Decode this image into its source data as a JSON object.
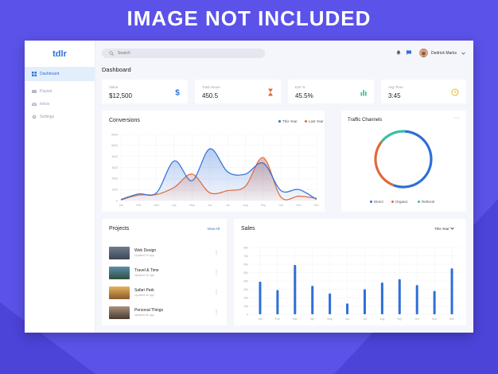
{
  "banner": {
    "text": "IMAGE NOT INCLUDED"
  },
  "sidebar": {
    "logo": "tdlr",
    "items": [
      {
        "label": "Dashboard",
        "icon": "grid-icon",
        "active": true
      },
      {
        "label": "Payout",
        "icon": "card-icon",
        "active": false
      },
      {
        "label": "Inbox",
        "icon": "mail-icon",
        "active": false
      },
      {
        "label": "Settings",
        "icon": "gear-icon",
        "active": false
      }
    ]
  },
  "header": {
    "search_placeholder": "Search",
    "user_name": "Dedrick Marks"
  },
  "page": {
    "title": "Dashboard"
  },
  "stats": [
    {
      "label": "Value",
      "value": "$12,500",
      "icon": "dollar-icon",
      "color": "#2e6fd8"
    },
    {
      "label": "Total Hours",
      "value": "450.5",
      "icon": "hourglass-icon",
      "color": "#e0683c"
    },
    {
      "label": "Exit %",
      "value": "45.5%",
      "icon": "bar-chart-icon",
      "color": "#36c08e"
    },
    {
      "label": "Avg Time",
      "value": "3:45",
      "icon": "clock-icon",
      "color": "#f0b429"
    }
  ],
  "conversions": {
    "title": "Conversions",
    "legend": {
      "this_year": "This Year",
      "last_year": "Last Year"
    },
    "colors": {
      "this_year": "#2e6fd8",
      "last_year": "#e0683c"
    }
  },
  "traffic": {
    "title": "Traffic Channels",
    "legend": [
      "Direct",
      "Organic",
      "Referral"
    ],
    "colors": [
      "#2e6fd8",
      "#e0683c",
      "#36c0a8"
    ]
  },
  "projects": {
    "title": "Projects",
    "view_all": "View All",
    "items": [
      {
        "name": "Web Design",
        "updated": "Updated 2h ago"
      },
      {
        "name": "Travel & Time",
        "updated": "Updated 3h ago"
      },
      {
        "name": "Safari Park",
        "updated": "Updated 5h ago"
      },
      {
        "name": "Personal Things",
        "updated": "Updated 6h ago"
      }
    ]
  },
  "sales": {
    "title": "Sales",
    "filter": "This Year"
  },
  "chart_data": [
    {
      "type": "area",
      "title": "Conversions",
      "categories": [
        "Jan",
        "Feb",
        "Mar",
        "Apr",
        "May",
        "Jun",
        "Jul",
        "Aug",
        "Sep",
        "Oct",
        "Nov",
        "Dec"
      ],
      "ylim": [
        0,
        6000
      ],
      "yticks": [
        "0",
        "1000",
        "2000",
        "3000",
        "4000",
        "5000",
        "6000"
      ],
      "series": [
        {
          "name": "This Year",
          "values": [
            100,
            600,
            700,
            3600,
            1800,
            4700,
            2600,
            2400,
            3400,
            900,
            1000,
            100
          ]
        },
        {
          "name": "Last Year",
          "values": [
            50,
            500,
            550,
            1200,
            2400,
            700,
            900,
            1300,
            3900,
            300,
            400,
            200
          ]
        }
      ]
    },
    {
      "type": "pie",
      "title": "Traffic Channels",
      "categories": [
        "Direct",
        "Organic",
        "Referral"
      ],
      "values": [
        55,
        30,
        15
      ]
    },
    {
      "type": "bar",
      "title": "Sales",
      "categories": [
        "Jan",
        "Feb",
        "Mar",
        "Apr",
        "May",
        "Jun",
        "Jul",
        "Aug",
        "Sep",
        "Oct",
        "Nov",
        "Dec"
      ],
      "ylim": [
        0,
        80
      ],
      "yticks": [
        "0",
        "10k",
        "20k",
        "30k",
        "40k",
        "50k",
        "60k",
        "70k",
        "80k"
      ],
      "values": [
        39,
        29,
        59,
        34,
        25,
        13,
        30,
        38,
        42,
        35,
        28,
        55
      ]
    }
  ]
}
